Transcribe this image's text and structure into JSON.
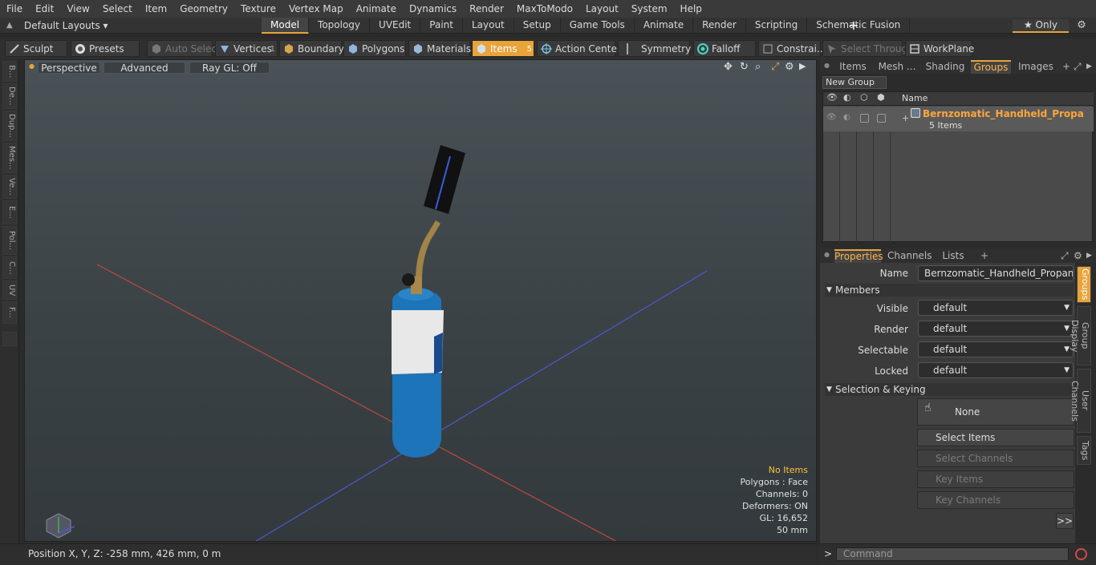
{
  "menu": [
    "File",
    "Edit",
    "View",
    "Select",
    "Item",
    "Geometry",
    "Texture",
    "Vertex Map",
    "Animate",
    "Dynamics",
    "Render",
    "MaxToModo",
    "Layout",
    "System",
    "Help"
  ],
  "layout": {
    "current": "Default Layouts ▾"
  },
  "tabs": [
    {
      "label": "Model",
      "active": true
    },
    {
      "label": "Topology"
    },
    {
      "label": "UVEdit"
    },
    {
      "label": "Paint"
    },
    {
      "label": "Layout"
    },
    {
      "label": "Setup"
    },
    {
      "label": "Game Tools"
    },
    {
      "label": "Animate"
    },
    {
      "label": "Render"
    },
    {
      "label": "Scripting"
    },
    {
      "label": "Schematic Fusion"
    }
  ],
  "tab_add": "+",
  "only_label": "★  Only",
  "toolbar": {
    "sculpt": "Sculpt",
    "presets": "Presets",
    "auto_select": "Auto Select",
    "vertices": "Vertices",
    "vertices_count": "1",
    "boundary": "Boundary",
    "polygons": "Polygons",
    "materials": "Materials",
    "items": "Items",
    "items_count": "5",
    "action_center": "Action Center",
    "symmetry": "Symmetry",
    "falloff": "Falloff",
    "constraints": "Constrai...",
    "select_through": "Select Through",
    "workplane": "WorkPlane"
  },
  "left_strip": [
    "B...",
    "De...",
    "Dup...",
    "Mes...",
    "Ve...",
    "E...",
    "Pol...",
    "C...",
    "UV",
    "F..."
  ],
  "viewport": {
    "perspective": "Perspective",
    "advanced": "Advanced",
    "raygl": "Ray GL: Off",
    "info": {
      "items": "No Items",
      "polygons": "Polygons : Face",
      "channels": "Channels: 0",
      "deformers": "Deformers: ON",
      "gl": "GL: 16,652",
      "scale": "50 mm"
    }
  },
  "right_tabs": [
    "Items",
    "Mesh ...",
    "Shading",
    "Groups",
    "Images"
  ],
  "right_tab_add": "+",
  "groups": {
    "new_group": "New Group",
    "header_name": "Name",
    "name": "Bernzomatic_Handheld_Propan ...",
    "count": "5 Items"
  },
  "prop_tabs": [
    "Properties",
    "Channels",
    "Lists"
  ],
  "prop_tab_add": "+",
  "properties": {
    "name_label": "Name",
    "name_value": "Bernzomatic_Handheld_Propane_Blow",
    "members": "Members",
    "visible_label": "Visible",
    "render_label": "Render",
    "selectable_label": "Selectable",
    "locked_label": "Locked",
    "default_value": "default",
    "selection_keying": "Selection & Keying",
    "none": "None",
    "select_items": "Select Items",
    "select_channels": "Select Channels",
    "key_items": "Key Items",
    "key_channels": "Key Channels",
    "more": ">>"
  },
  "vertical_tabs": [
    "Groups",
    "Group Display",
    "User Channels",
    "Tags"
  ],
  "status": {
    "position": "Position X, Y, Z:   -258 mm, 426 mm, 0 m"
  },
  "command": {
    "placeholder": "Command",
    "prompt": ">"
  },
  "colors": {
    "accent": "#e8a33a",
    "group_name": "#ffa63a",
    "info_highlight": "#ffc13b"
  }
}
